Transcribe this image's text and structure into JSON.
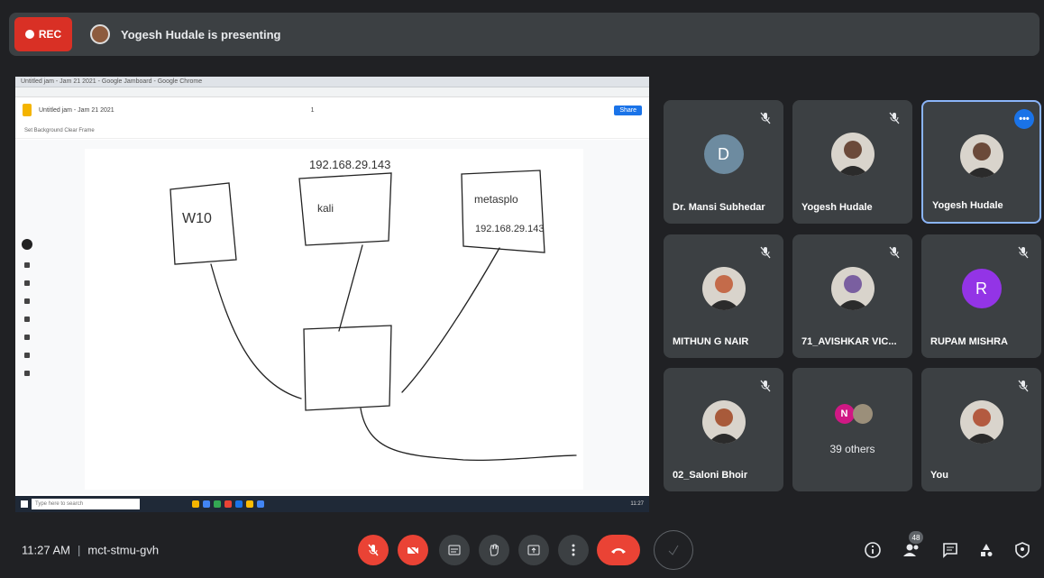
{
  "recording": {
    "label": "REC",
    "color": "#d93025"
  },
  "presenting_banner": {
    "text": "Yogesh Hudale is presenting"
  },
  "shared_screen": {
    "window_title": "Untitled jam - Jam 21 2021 - Google Jamboard - Google Chrome",
    "doc_title": "Untitled jam - Jam 21 2021",
    "frame_indicator": "1",
    "share_button": "Share",
    "tools": "Set Background   Clear Frame",
    "taskbar_search": "Type here to search",
    "taskbar_clock": "11:27",
    "drawing": {
      "ip_top": "192.168.29.143",
      "box_w10": "W10",
      "box_kali": "kali",
      "box_metasplo": "metasplo",
      "ip_metasplo": "192.168.29.143"
    }
  },
  "participants": [
    {
      "name": "Dr. Mansi Subhedar",
      "initial": "D",
      "avatar_color": "#6d8ba0",
      "muted": true
    },
    {
      "name": "Yogesh Hudale",
      "photo": true,
      "muted": true
    },
    {
      "name": "Yogesh Hudale",
      "photo": true,
      "muted": true,
      "active": true,
      "more_label": "•••"
    },
    {
      "name": "MITHUN G NAIR",
      "photo": true,
      "muted": true
    },
    {
      "name": "71_AVISHKAR VIC...",
      "photo": true,
      "muted": true
    },
    {
      "name": "RUPAM MISHRA",
      "initial": "R",
      "avatar_color": "#9334e6",
      "muted": true
    },
    {
      "name": "02_Saloni Bhoir",
      "photo": true,
      "muted": true
    },
    {
      "name": "39 others",
      "others": true,
      "initial": "N",
      "muted": false
    },
    {
      "name": "You",
      "photo": true,
      "muted": true
    }
  ],
  "bottom": {
    "time": "11:27 AM",
    "separator": "|",
    "meeting_code": "mct-stmu-gvh",
    "people_count": "48"
  }
}
